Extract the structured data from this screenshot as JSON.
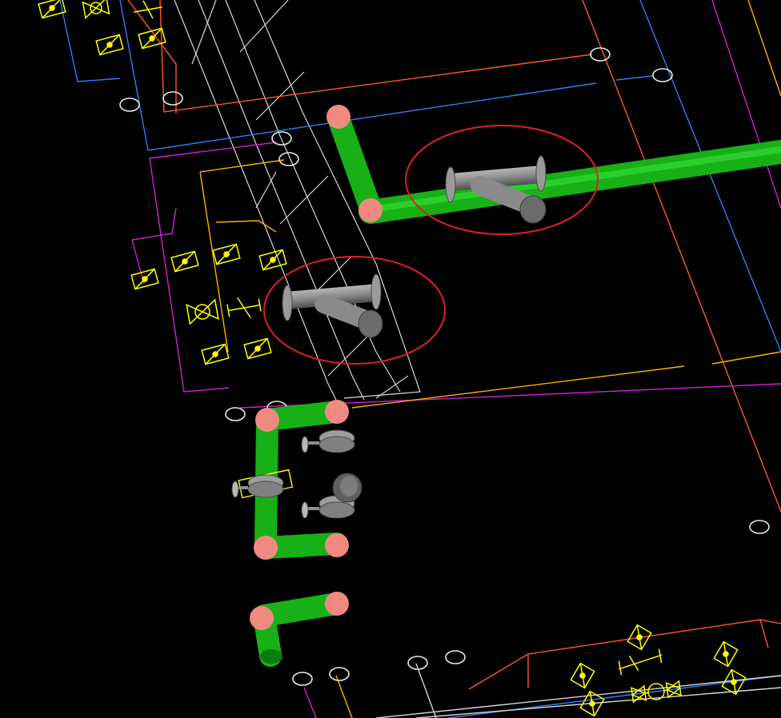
{
  "viewport": {
    "background": "#000000"
  },
  "colors": {
    "pipe": "#1bc41b",
    "pipe_dark": "#128a12",
    "elbow": "#f08a80",
    "valve_metal": "#8e8e8e",
    "valve_dark": "#555555",
    "highlight": "#e02020",
    "line_white": "#d8d8d8",
    "line_orange": "#ff5a1a",
    "line_blue": "#2a80ff",
    "line_magenta": "#d020d0",
    "line_amber": "#ffb000",
    "symbol_yellow": "#ffff00"
  },
  "annotations": {
    "highlight_count": 2,
    "highlight_style": "red-ellipse"
  },
  "components": {
    "strainer_count": 2,
    "inline_valve_count": 3,
    "instrument_icon": "gauge-icon"
  }
}
